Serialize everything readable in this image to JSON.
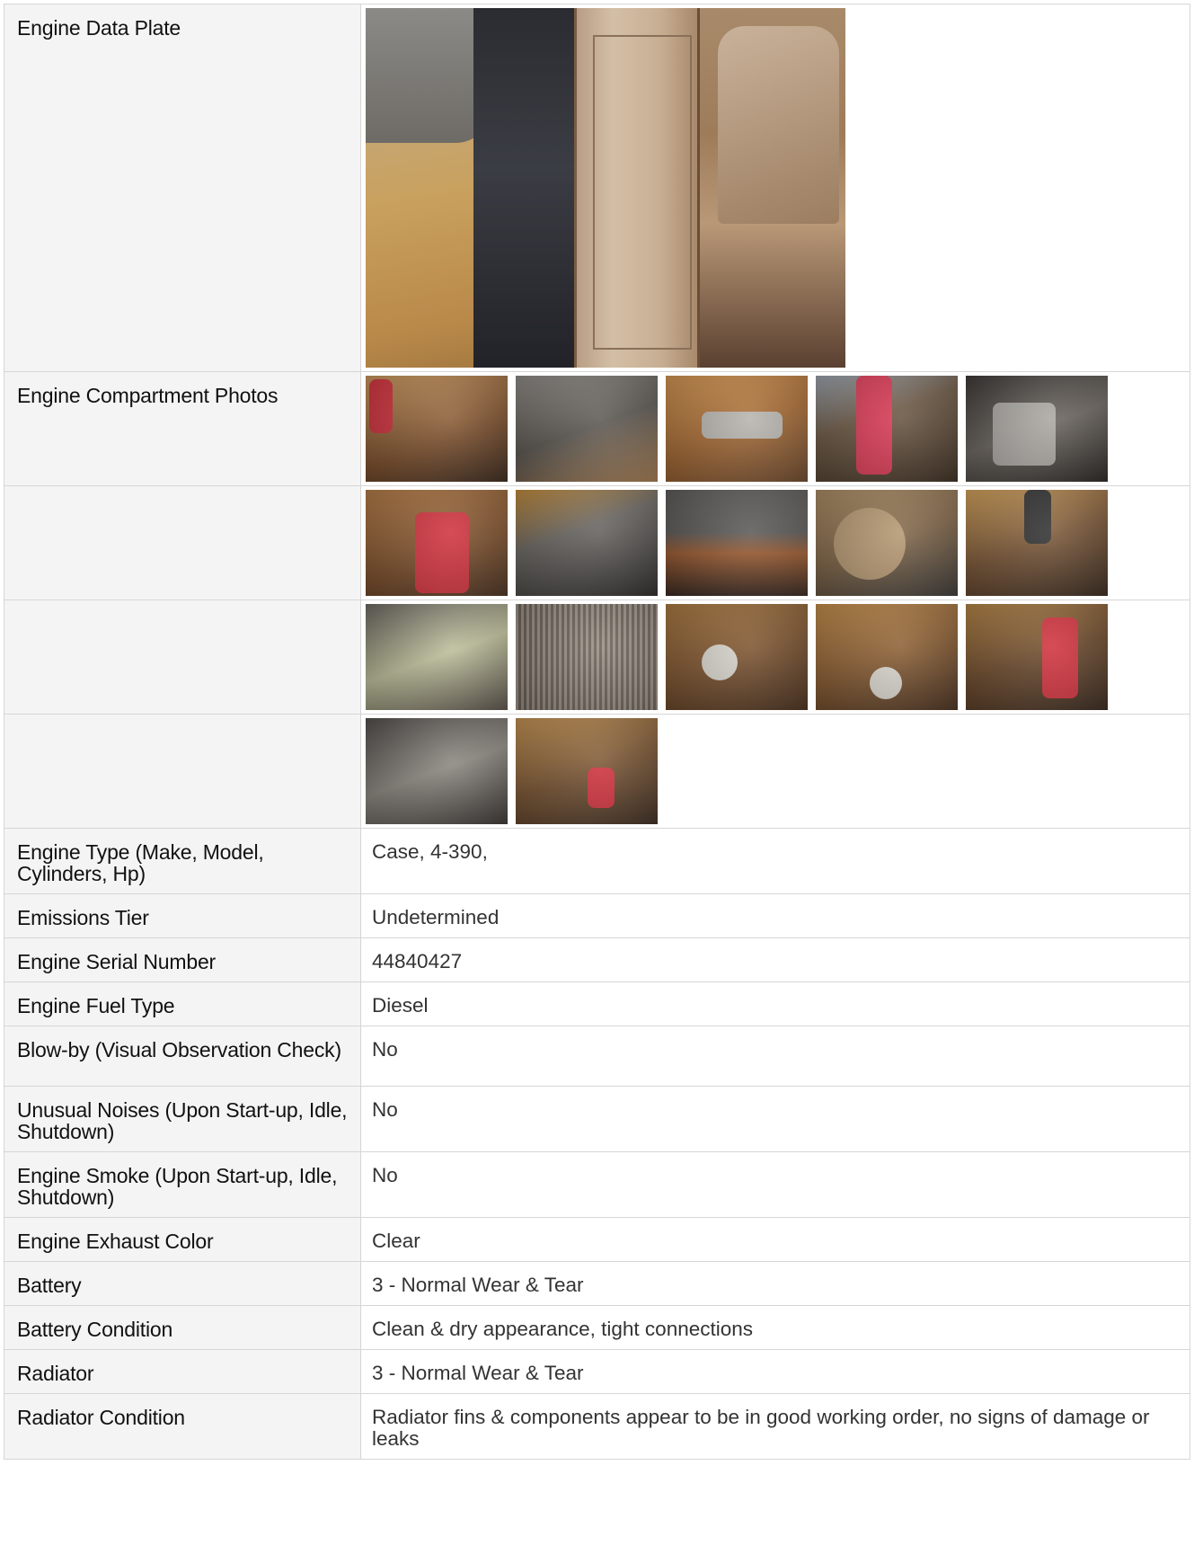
{
  "rows": {
    "data_plate": {
      "label": "Engine Data Plate"
    },
    "compartment": {
      "label": "Engine Compartment Photos"
    },
    "engine_type": {
      "label": "Engine Type (Make, Model, Cylinders, Hp)",
      "value": "Case, 4-390,"
    },
    "emissions": {
      "label": "Emissions Tier",
      "value": "Undetermined"
    },
    "serial": {
      "label": "Engine Serial Number",
      "value": "44840427"
    },
    "fuel": {
      "label": "Engine Fuel Type",
      "value": "Diesel"
    },
    "blowby": {
      "label": "Blow-by (Visual Observation Check)",
      "value": "No"
    },
    "noises": {
      "label": "Unusual Noises (Upon Start-up, Idle, Shutdown)",
      "value": "No"
    },
    "smoke": {
      "label": "Engine Smoke (Upon Start-up, Idle, Shutdown)",
      "value": "No"
    },
    "exhaust": {
      "label": "Engine Exhaust Color",
      "value": "Clear"
    },
    "battery": {
      "label": "Battery",
      "value": "3 - Normal Wear & Tear"
    },
    "battery_condition": {
      "label": "Battery Condition",
      "value": "Clean & dry appearance, tight connections"
    },
    "radiator": {
      "label": "Radiator",
      "value": "3 - Normal Wear & Tear"
    },
    "radiator_condition": {
      "label": "Radiator Condition",
      "value": "Radiator fins & components appear to be in good working order, no signs of damage or leaks"
    }
  },
  "thumbnail_colors": {
    "row1": [
      "#a06a3c",
      "#6d6a66",
      "#b07b42",
      "#8a6a48",
      "#5b554f"
    ],
    "row2": [
      "#9a6a40",
      "#6b6660",
      "#7a5536",
      "#8d7557",
      "#6a5846"
    ],
    "row3": [
      "#7d7060",
      "#7a7268",
      "#8a6b45",
      "#9a7445",
      "#8c6a44"
    ],
    "row4": [
      "#5d5a55",
      "#6f5a44"
    ]
  },
  "accent_colors": {
    "red_filter": "#d0343f",
    "label_bg": "#f4f4f4",
    "border": "#d6d6d6"
  }
}
